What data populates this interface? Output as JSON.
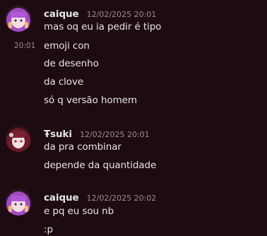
{
  "messages": [
    {
      "username": "caique",
      "timestamp": "12/02/2025 20:01",
      "hover_time": "20:01",
      "avatar_icon": "anime-girl-purple-hair-avatar",
      "lines": [
        "mas oq eu ia pedir é tipo",
        "emoji con",
        "de desenho",
        "da clove",
        "só q versão homem"
      ]
    },
    {
      "username": "Ŧsuki",
      "timestamp": "12/02/2025 20:01",
      "avatar_icon": "anime-girl-red-hair-avatar",
      "lines": [
        "da pra combinar",
        "depende da quantidade"
      ]
    },
    {
      "username": "caique",
      "timestamp": "12/02/2025 20:02",
      "avatar_icon": "anime-girl-purple-hair-avatar",
      "lines": [
        "e pq eu sou nb",
        ":p"
      ]
    }
  ],
  "colors": {
    "background": "#1c0b10",
    "username": "#e6e6e6",
    "timestamp": "#9a8e93",
    "text": "#e8e4e6"
  }
}
